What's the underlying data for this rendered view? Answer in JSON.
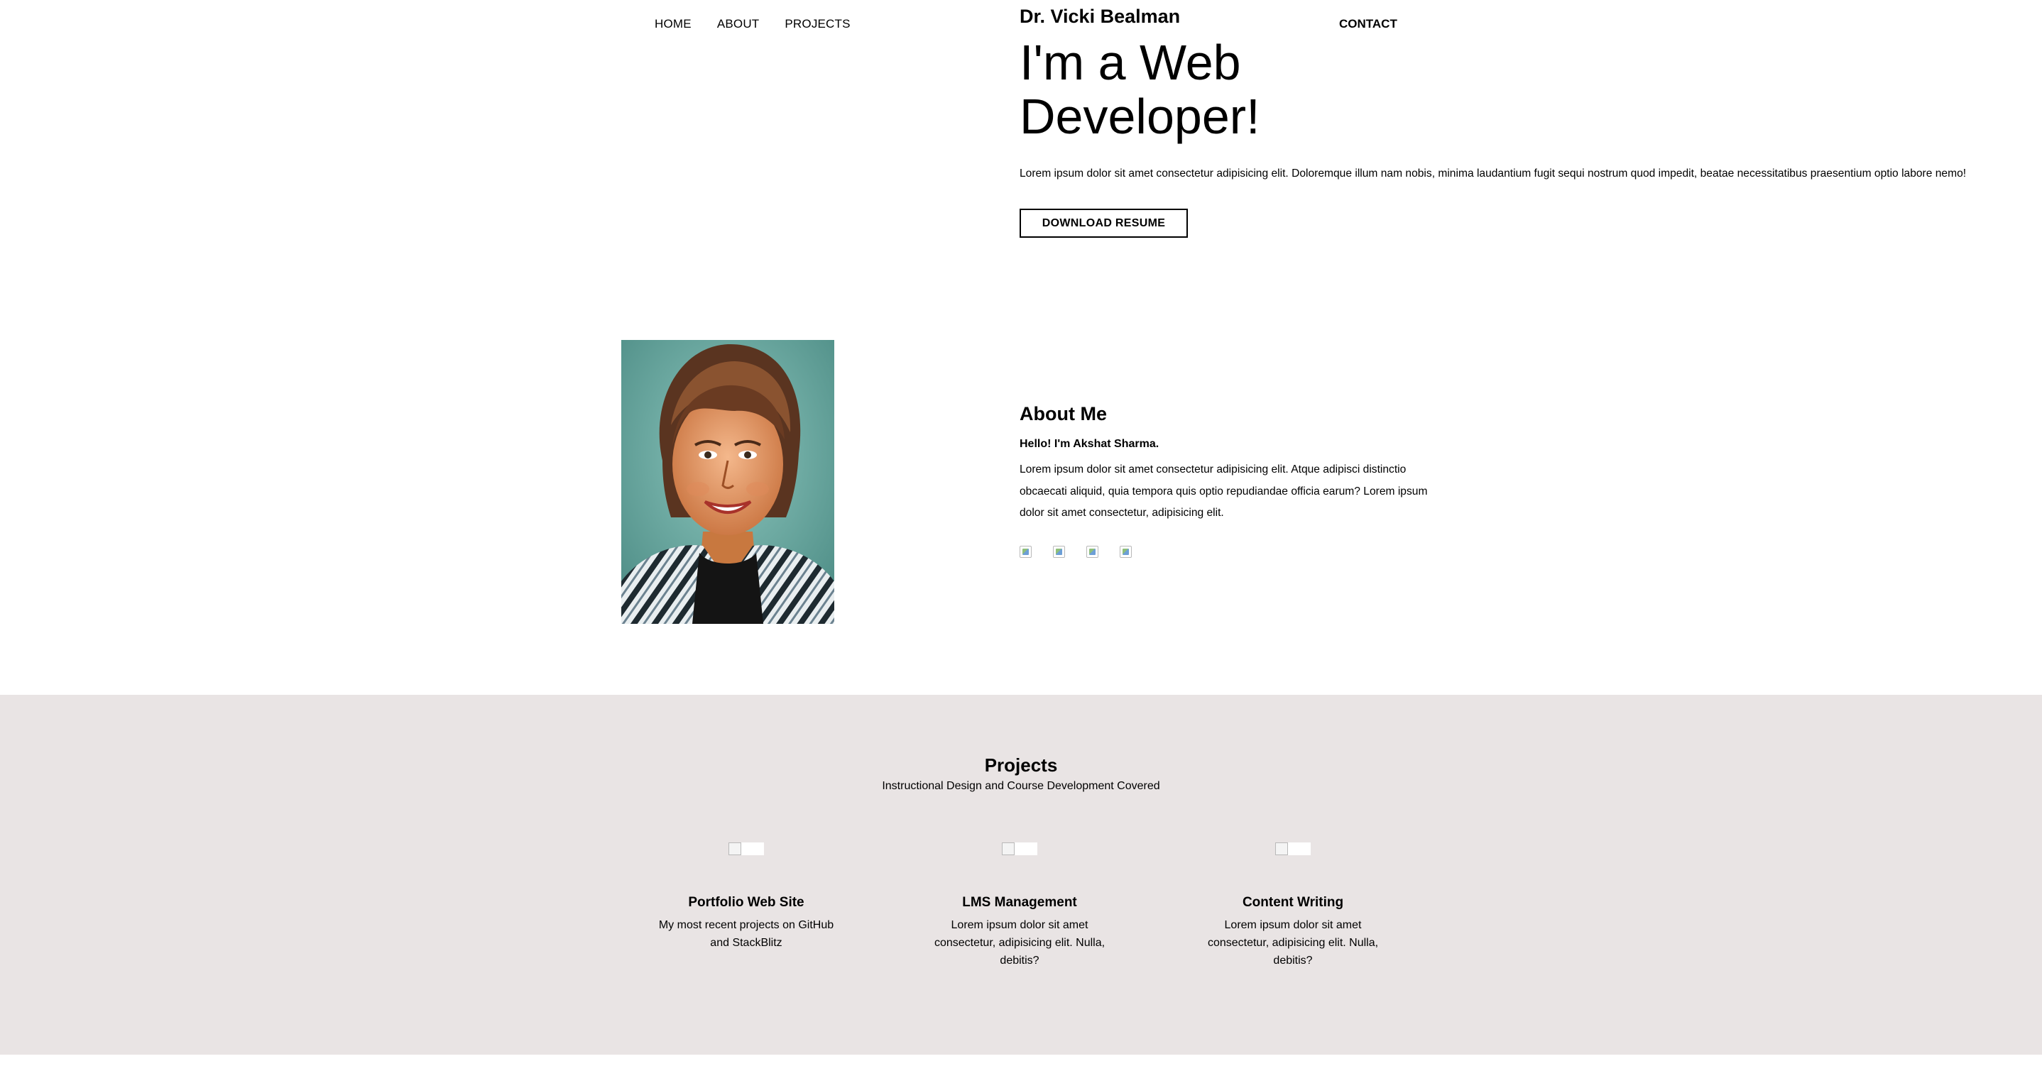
{
  "nav": {
    "home": "HOME",
    "about": "ABOUT",
    "projects": "PROJECTS",
    "contact": "CONTACT"
  },
  "hero": {
    "name": "Dr. Vicki Bealman",
    "title": "I'm a Web Developer!",
    "text": "Lorem ipsum dolor sit amet consectetur adipisicing elit. Doloremque illum nam nobis, minima laudantium fugit sequi nostrum quod impedit, beatae necessitatibus praesentium optio labore nemo!",
    "button": "DOWNLOAD RESUME"
  },
  "about": {
    "heading": "About Me",
    "greeting": "Hello! I'm Akshat Sharma.",
    "text": "Lorem ipsum dolor sit amet consectetur adipisicing elit. Atque adipisci distinctio obcaecati aliquid, quia tempora quis optio repudiandae officia earum? Lorem ipsum dolor sit amet consectetur, adipisicing elit.",
    "portrait": "portrait-image",
    "social_icons": [
      "broken-image-icon",
      "broken-image-icon",
      "broken-image-icon",
      "broken-image-icon"
    ]
  },
  "projects": {
    "heading": "Projects",
    "subtitle": "Instructional Design and Course Development Covered",
    "items": [
      {
        "title": "Portfolio Web Site",
        "desc": "My most recent projects on GitHub and StackBlitz",
        "image": "broken-image-icon"
      },
      {
        "title": "LMS Management",
        "desc": "Lorem ipsum dolor sit amet consectetur, adipisicing elit. Nulla, debitis?",
        "image": "broken-image-icon"
      },
      {
        "title": "Content Writing",
        "desc": "Lorem ipsum dolor sit amet consectetur, adipisicing elit. Nulla, debitis?",
        "image": "broken-image-icon"
      }
    ]
  },
  "colors": {
    "background": "#ffffff",
    "projects_background": "#e9e4e4",
    "portrait_backdrop": "#5fa39a",
    "text": "#000000"
  }
}
